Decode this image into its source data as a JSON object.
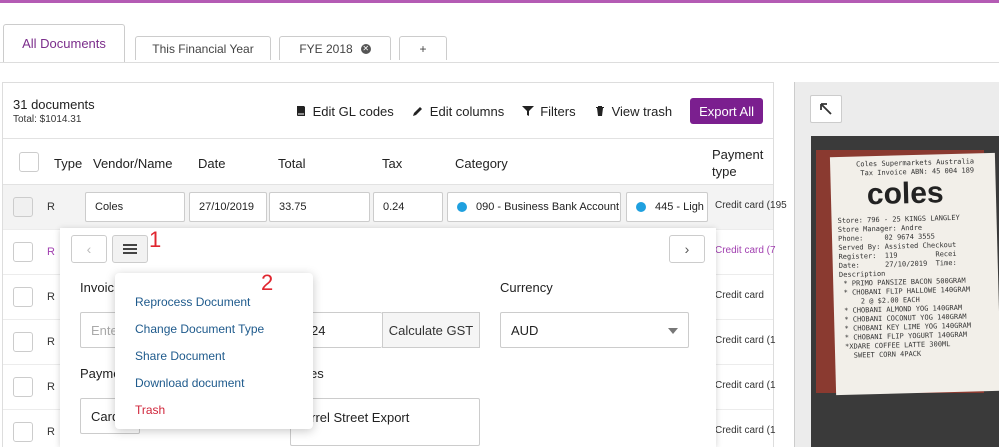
{
  "tabs": [
    {
      "label": "All Documents",
      "active": true
    },
    {
      "label": "This Financial Year"
    },
    {
      "label": "FYE 2018",
      "closable": true
    },
    {
      "label": "+"
    }
  ],
  "summary": {
    "count": "31 documents",
    "total": "Total: $1014.31"
  },
  "toolbar": {
    "edit_gl": "Edit GL codes",
    "edit_columns": "Edit columns",
    "filters": "Filters",
    "view_trash": "View trash",
    "export_all": "Export All"
  },
  "columns": {
    "type": "Type",
    "vendor": "Vendor/Name",
    "date": "Date",
    "total": "Total",
    "tax": "Tax",
    "category": "Category",
    "payment_line1": "Payment",
    "payment_line2": "type"
  },
  "selected_row": {
    "type": "R",
    "vendor": "Coles",
    "date": "27/10/2019",
    "total": "33.75",
    "tax": "0.24",
    "category": "090 - Business Bank Account",
    "gl": "445 - Ligh",
    "payment": "Credit card (195"
  },
  "rows": [
    {
      "type": "R",
      "payment": "Credit card (7"
    },
    {
      "type": "R",
      "payment": "Credit card"
    },
    {
      "type": "R",
      "payment": "Credit card (1"
    },
    {
      "type": "R",
      "payment": "Credit card (1"
    },
    {
      "type": "R",
      "payment": "Credit card (1"
    }
  ],
  "editor": {
    "invoice_label": "Invoic",
    "invoice_placeholder": "Ente",
    "tax_value": "24",
    "calculate_gst": "Calculate GST",
    "currency_label": "Currency",
    "currency_value": "AUD",
    "payment_label": "Payme",
    "payment_value": "Card",
    "notes_label": "es",
    "notes_value": "uirrel Street Export",
    "prev_icon": "chevron-left-icon",
    "next_icon": "chevron-right-icon"
  },
  "menu": {
    "items": [
      {
        "label": "Reprocess Document"
      },
      {
        "label": "Change Document Type"
      },
      {
        "label": "Share Document"
      },
      {
        "label": "Download document"
      },
      {
        "label": "Trash",
        "danger": true
      }
    ]
  },
  "markers": {
    "one": "1",
    "two": "2"
  },
  "receipt": {
    "header1": "Coles Supermarkets Australia",
    "header2": "Tax Invoice ABN: 45 004 189",
    "logo": "coles",
    "lines": [
      "Store: 796 - 25 KINGS LANGLEY",
      "Store Manager: Andre",
      "Phone:     02 9674 3555",
      "Served By: Assisted Checkout",
      "Register:  119         Recei",
      "Date:      27/10/2019  Time:",
      "",
      "Description",
      "",
      " * PRIMO PANSIZE BACON 500GRAM",
      " * CHOBANI FLIP HALLOWE 140GRAM",
      "     2 @ $2.00 EACH",
      " * CHOBANI ALMOND YOG 140GRAM",
      " * CHOBANI COCONUT YOG 140GRAM",
      " * CHOBANI KEY LIME YOG 140GRAM",
      " * CHOBANI FLIP YOGURT 140GRAM",
      " *XDARE COFFEE LATTE 300ML",
      "   SWEET CORN 4PACK"
    ]
  },
  "colors": {
    "accent": "#7b1f8f",
    "topbar": "#b45bb4",
    "link": "#1e5a8c",
    "danger": "#d0263b",
    "marker": "#e0262f"
  }
}
